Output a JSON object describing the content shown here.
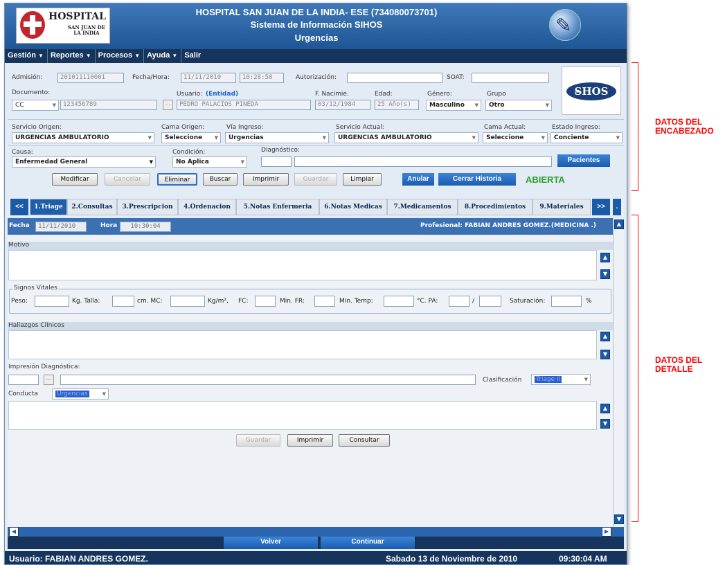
{
  "header": {
    "logo_hospital": "HOSPITAL",
    "logo_sub": "SAN JUAN DE LA INDIA",
    "title1": "HOSPITAL SAN JUAN DE LA INDIA- ESE (734080073701)",
    "title2": "Sistema de Información SIHOS",
    "title3": "Urgencias",
    "sihos_logo": "S̶HOS"
  },
  "menu": [
    "Gestión",
    "Reportes",
    "Procesos",
    "Ayuda",
    "Salir"
  ],
  "encabezado": {
    "admision_label": "Admisión:",
    "admision_value": "201011110001",
    "fecha_hora_label": "Fecha/Hora:",
    "fecha_value": "11/11/2010",
    "hora_value": "10:28:58",
    "autorizacion_label": "Autorización:",
    "soat_label": "SOAT:",
    "documento_label": "Documento:",
    "tipo_doc": "CC",
    "documento_value": "123456789",
    "usuario_label": "Usuario:",
    "entidad_label": "(Entidad)",
    "usuario_value": "PEDRO  PALACIOS PINEDA",
    "f_nacimiento_label": "F. Nacimie.",
    "f_nacimiento_value": "03/12/1984",
    "edad_label": "Edad:",
    "edad_value": "25 Año(s)",
    "genero_label": "Género:",
    "genero_value": "Masculino",
    "grupo_label": "Grupo",
    "grupo_value": "Otro",
    "servicio_origen_label": "Servicio Origen:",
    "servicio_origen_value": "URGENCIAS AMBULATORIO",
    "cama_origen_label": "Cama Origen:",
    "cama_origen_value": "Seleccione",
    "via_ingreso_label": "Vía Ingreso:",
    "via_ingreso_value": "Urgencias",
    "servicio_actual_label": "Servicio Actual:",
    "servicio_actual_value": "URGENCIAS AMBULATORIO",
    "cama_actual_label": "Cama Actual:",
    "cama_actual_value": "Seleccione",
    "estado_ingreso_label": "Estado Ingreso:",
    "estado_ingreso_value": "Conciente",
    "causa_label": "Causa:",
    "causa_value": "Enfermedad General",
    "condicion_label": "Condición:",
    "condicion_value": "No Aplica",
    "diagnostico_label": "Diagnóstico:",
    "pacientes_btn": "Pacientes",
    "buttons": {
      "modificar": "Modificar",
      "cancelar": "Cancelar",
      "eliminar": "Eliminar",
      "buscar": "Buscar",
      "imprimir": "Imprimir",
      "guardar": "Guardar",
      "limpiar": "Limpiar",
      "anular": "Anular",
      "cerrar_historia": "Cerrar Historia"
    },
    "estado": "ABIERTA"
  },
  "tabs": {
    "prev": "<<",
    "next": ">>",
    "more": ".",
    "items": [
      "1.Triage",
      "2.Consultas",
      "3.Prescripcion",
      "4.Ordenacion",
      "5.Notas Enfermeria",
      "6.Notas Medicas",
      "7.Medicamentos",
      "8.Procedimientos",
      "9.Materiales"
    ]
  },
  "detalle": {
    "fecha_label": "Fecha",
    "fecha_value": "11/11/2010",
    "hora_label": "Hora",
    "hora_value": "10:30:04",
    "profesional": "Profesional: FABIAN ANDRES GOMEZ.(MEDICINA .)",
    "motivo_label": "Motivo",
    "signos_label": "Signos Vitales",
    "peso_label": "Peso:",
    "kg_talla_label": "Kg. Talla:",
    "cm_mc_label": "cm. MC:",
    "kgm2_label": "Kg/m²,",
    "fc_label": "FC:",
    "min_fr_label": "Min. FR:",
    "min_temp_label": "Min. Temp:",
    "c_pa_label": "°C. PA:",
    "slash": "/",
    "saturacion_label": "Saturación:",
    "pct": "%",
    "hallazgos_label": "Hallazgos Clínicos",
    "impresion_label": "Impresión Diagnóstica:",
    "clasificacion_label": "Clasificación",
    "clasificacion_value": "Triage II",
    "conducta_label": "Conducta",
    "conducta_value": "Urgencias",
    "guardar": "Guardar",
    "imprimir": "Imprimir",
    "consultar": "Consultar"
  },
  "bottom": {
    "volver": "Volver",
    "continuar": "Continuar"
  },
  "status": {
    "usuario": "Usuario: FABIAN ANDRES GOMEZ.",
    "fecha": "Sabado 13 de Noviembre de 2010",
    "hora": "09:30:04 AM"
  },
  "annotations": {
    "encabezado": "DATOS DEL ENCABEZADO",
    "detalle": "DATOS DEL DETALLE"
  }
}
